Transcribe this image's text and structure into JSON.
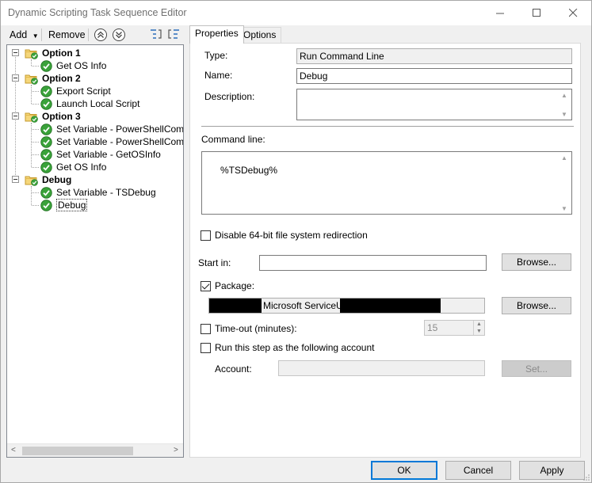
{
  "window": {
    "title": "Dynamic Scripting Task Sequence Editor"
  },
  "toolbar": {
    "add_label": "Add",
    "remove_label": "Remove"
  },
  "tree": {
    "groups": [
      {
        "label": "Option 1",
        "items": [
          "Get OS Info"
        ]
      },
      {
        "label": "Option 2",
        "items": [
          "Export Script",
          "Launch Local Script"
        ]
      },
      {
        "label": "Option 3",
        "items": [
          "Set Variable - PowerShellCommand",
          "Set Variable - PowerShellCommand",
          "Set Variable - GetOSInfo",
          "Get OS Info"
        ]
      },
      {
        "label": "Debug",
        "items": [
          "Set Variable - TSDebug",
          "Debug"
        ]
      }
    ],
    "selected": "Debug"
  },
  "tabs": [
    {
      "label": "Properties"
    },
    {
      "label": "Options"
    }
  ],
  "properties": {
    "type_label": "Type:",
    "type_value": "Run Command Line",
    "name_label": "Name:",
    "name_value": "Debug",
    "description_label": "Description:",
    "description_value": "",
    "command_label": "Command line:",
    "command_value": "%TSDebug%",
    "disable_redirect_label": "Disable 64-bit file system redirection",
    "start_in_label": "Start in:",
    "start_in_value": "",
    "browse_label": "Browse...",
    "package_label": "Package:",
    "package_value": "Microsoft ServiceUI",
    "timeout_label": "Time-out (minutes):",
    "timeout_value": "15",
    "run_as_label": "Run this step as the following account",
    "account_label": "Account:",
    "account_value": "",
    "set_label": "Set..."
  },
  "footer": {
    "ok_label": "OK",
    "cancel_label": "Cancel",
    "apply_label": "Apply"
  }
}
